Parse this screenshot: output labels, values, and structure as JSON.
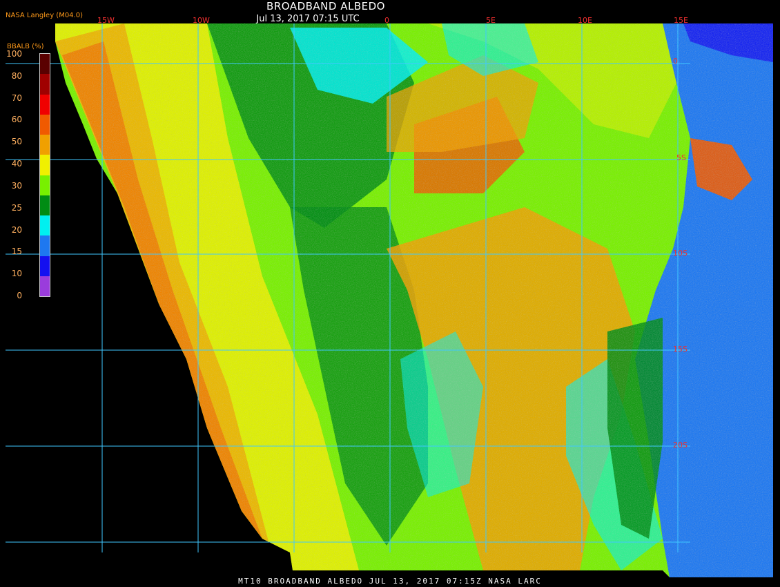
{
  "header": {
    "title": "BROADBAND ALBEDO",
    "subtitle": "Jul 13, 2017 07:15 UTC",
    "source": "NASA Langley (M04.0)"
  },
  "legend": {
    "title": "BBALB (%)",
    "ticks": [
      "0",
      "10",
      "15",
      "20",
      "25",
      "30",
      "40",
      "50",
      "60",
      "70",
      "80",
      "100"
    ],
    "colors": [
      "#9a3cdc",
      "#1410f0",
      "#1e78f0",
      "#00f0f0",
      "#008c14",
      "#78f000",
      "#f0f000",
      "#f0a000",
      "#f05a00",
      "#f00000",
      "#a00000",
      "#5a0000"
    ]
  },
  "grid": {
    "longitude_labels": [
      "15W",
      "10W",
      "0",
      "5E",
      "10E",
      "15E"
    ],
    "latitude_labels": [
      "0",
      "5S",
      "10S",
      "15S",
      "20S"
    ]
  },
  "footer": {
    "text": "MT10  BROADBAND ALBEDO   JUL 13, 2017 07:15Z   NASA LARC"
  },
  "colors": {
    "grid_line": "#40c8ff",
    "label_text": "#ff9a1a",
    "grid_label": "#f03030"
  }
}
